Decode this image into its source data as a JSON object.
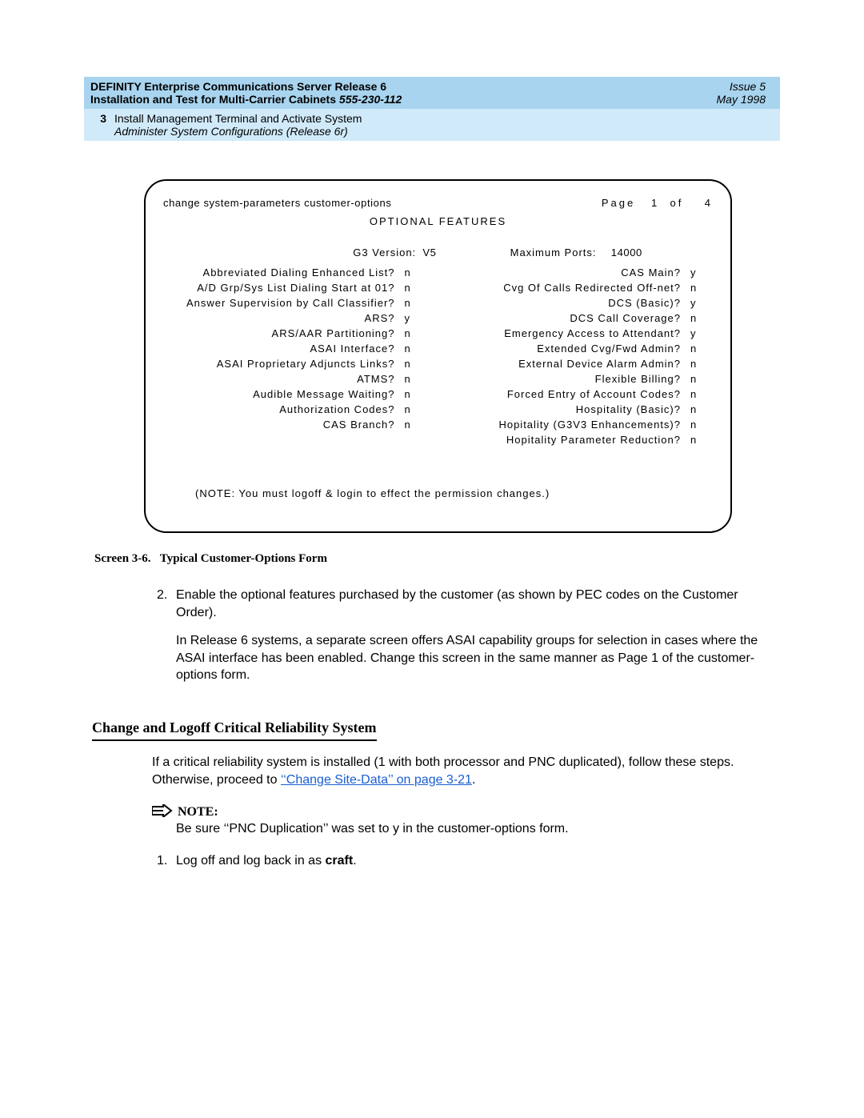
{
  "header": {
    "title_line1": "DEFINITY Enterprise Communications Server Release 6",
    "title_line2_a": "Installation and Test for Multi-Carrier Cabinets  ",
    "title_line2_b": "555-230-112",
    "issue": "Issue 5",
    "date": "May 1998",
    "chapter_num": "3",
    "chapter_title": "Install Management Terminal and Activate System",
    "chapter_sub": "Administer System Configurations (Release 6r)"
  },
  "terminal": {
    "cmd": "change  system-parameters  customer-options",
    "page_label": "Page   1  of    4",
    "section_title": "OPTIONAL  FEATURES",
    "g3_label": "G3  Version:",
    "g3_value": "V5",
    "maxports_label": "Maximum  Ports:",
    "maxports_value": "14000",
    "left_items": [
      {
        "label": "Abbreviated  Dialing  Enhanced  List?",
        "val": "n"
      },
      {
        "label": "A/D  Grp/Sys  List  Dialing  Start  at  01?",
        "val": "n"
      },
      {
        "label": "Answer  Supervision  by  Call  Classifier?",
        "val": "n"
      },
      {
        "label": "ARS?",
        "val": "y"
      },
      {
        "label": "ARS/AAR  Partitioning?",
        "val": "n"
      },
      {
        "label": "ASAI  Interface?",
        "val": "n"
      },
      {
        "label": "ASAI  Proprietary  Adjuncts  Links?",
        "val": "n"
      },
      {
        "label": "ATMS?",
        "val": "n"
      },
      {
        "label": "Audible  Message  Waiting?",
        "val": "n"
      },
      {
        "label": "Authorization  Codes?",
        "val": "n"
      },
      {
        "label": "CAS  Branch?",
        "val": "n"
      }
    ],
    "right_items": [
      {
        "label": "CAS  Main?",
        "val": "y"
      },
      {
        "label": "Cvg  Of  Calls  Redirected  Off-net?",
        "val": "n"
      },
      {
        "label": "DCS  (Basic)?",
        "val": "y"
      },
      {
        "label": "DCS  Call  Coverage?",
        "val": "n"
      },
      {
        "label": "Emergency  Access  to  Attendant?",
        "val": "y"
      },
      {
        "label": "Extended  Cvg/Fwd  Admin?",
        "val": "n"
      },
      {
        "label": "External  Device  Alarm  Admin?",
        "val": "n"
      },
      {
        "label": "Flexible  Billing?",
        "val": "n"
      },
      {
        "label": "Forced  Entry  of  Account  Codes?",
        "val": "n"
      },
      {
        "label": "Hospitality  (Basic)?",
        "val": "n"
      },
      {
        "label": "Hopitality  (G3V3  Enhancements)?",
        "val": "n"
      },
      {
        "label": "Hopitality  Parameter  Reduction?",
        "val": "n"
      }
    ],
    "note": "(NOTE:  You  must  logoff  &  login  to  effect  the  permission  changes.)"
  },
  "caption": {
    "label": "Screen 3-6.",
    "text": "Typical Customer-Options Form"
  },
  "para": {
    "num": "2.",
    "p1": "Enable the optional features purchased by the customer (as shown by PEC codes on the Customer Order).",
    "p2": "In Release 6 systems, a separate screen offers ASAI capability groups for selection in cases where the ASAI interface has been enabled. Change this screen in the same manner as Page 1 of the customer-options form."
  },
  "h2": "Change and Logoff Critical Reliability System",
  "para2_a": "If a critical reliability system is installed (1 with both processor and PNC duplicated), follow these steps. Otherwise, proceed to ",
  "para2_link": "‘‘Change Site-Data’’ on page 3-21",
  "para2_b": ".",
  "note_label": "NOTE:",
  "note_text_a": "Be sure ‘‘PNC Duplication’’",
  "note_text_b": " was set to y in the customer-options form.",
  "step1_num": "1.",
  "step1_a": "Log off and log back in as ",
  "step1_b": "craft",
  "step1_c": "."
}
